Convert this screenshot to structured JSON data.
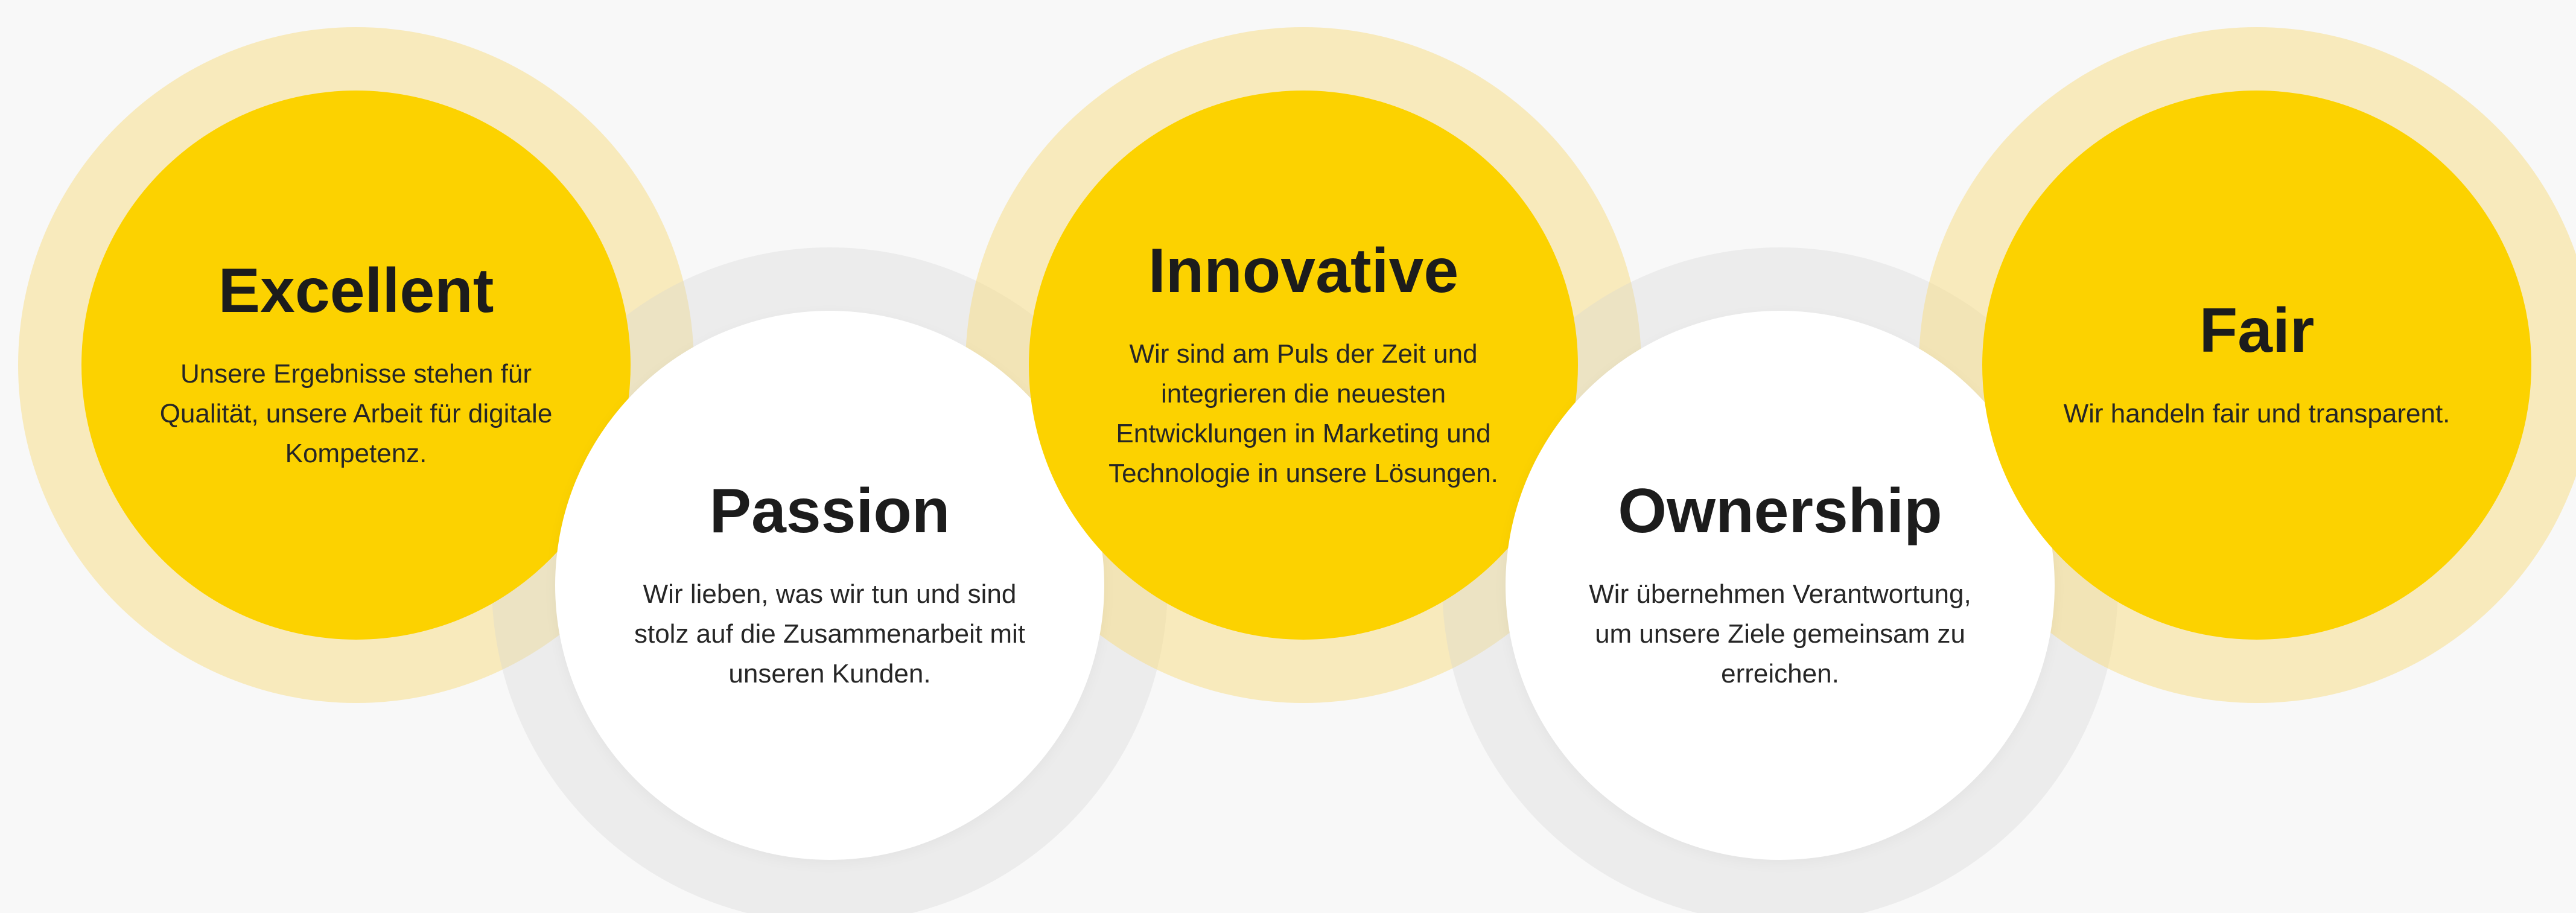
{
  "values": [
    {
      "title": "Excellent",
      "text": "Unsere Ergebnisse stehen für Qualität, unsere Arbeit für digitale Kompetenz."
    },
    {
      "title": "Passion",
      "text": "Wir lieben, was wir tun und sind stolz auf die Zusammenarbeit mit unseren Kunden."
    },
    {
      "title": "Innovative",
      "text": "Wir sind am Puls der Zeit und integrieren die neuesten Entwicklungen in Marketing und Technologie in unsere Lösungen."
    },
    {
      "title": "Ownership",
      "text": "Wir übernehmen Verantwortung, um unsere Ziele gemeinsam zu erreichen."
    },
    {
      "title": "Fair",
      "text": "Wir handeln fair und transparent."
    }
  ],
  "colors": {
    "accent_yellow": "#fcd200",
    "halo_yellow": "#f7de8a",
    "halo_grey": "#d4d4d4",
    "background": "#f8f8f8",
    "circle_white": "#ffffff"
  }
}
